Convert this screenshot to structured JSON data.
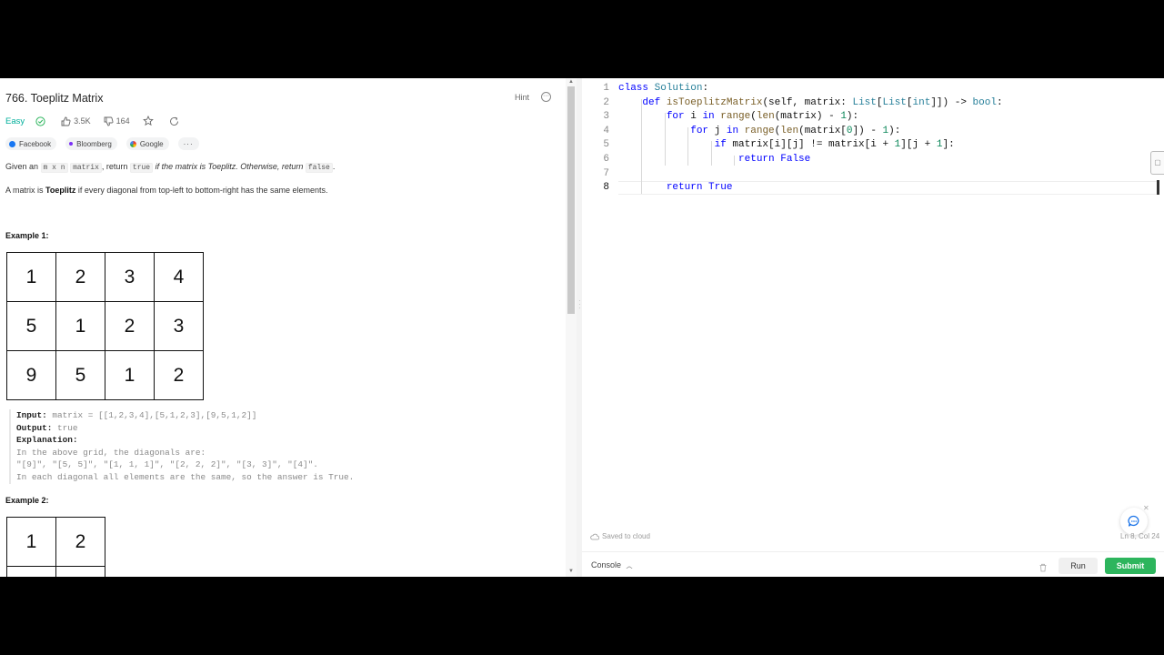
{
  "problem": {
    "title": "766. Toeplitz Matrix",
    "hint_label": "Hint",
    "difficulty": "Easy",
    "likes": "3.5K",
    "dislikes": "164",
    "tags": [
      {
        "label": "Facebook",
        "color": "#1877f2"
      },
      {
        "label": "Bloomberg",
        "color": "#7b2ff7"
      },
      {
        "label": "Google",
        "color": "#ea4335"
      }
    ],
    "more_tags": "···",
    "desc1": {
      "given": "Given an ",
      "mxn": "m x n",
      "matrix": "matrix",
      "return1": ", return ",
      "true": "true",
      "mid": " if the matrix is Toeplitz. Otherwise, return ",
      "false": "false",
      "end": "."
    },
    "desc2": {
      "pre": "A matrix is ",
      "bold": "Toeplitz",
      "post": " if every diagonal from top-left to bottom-right has the same elements."
    }
  },
  "example1": {
    "title": "Example 1:",
    "grid": [
      [
        "1",
        "2",
        "3",
        "4"
      ],
      [
        "5",
        "1",
        "2",
        "3"
      ],
      [
        "9",
        "5",
        "1",
        "2"
      ]
    ],
    "input_label": "Input:",
    "input": " matrix = [[1,2,3,4],[5,1,2,3],[9,5,1,2]]",
    "output_label": "Output:",
    "output": " true",
    "explanation_label": "Explanation:",
    "explanation_lines": [
      "In the above grid, the diagonals are:",
      "\"[9]\", \"[5, 5]\", \"[1, 1, 1]\", \"[2, 2, 2]\", \"[3, 3]\", \"[4]\".",
      "In each diagonal all elements are the same, so the answer is True."
    ]
  },
  "example2": {
    "title": "Example 2:",
    "grid_top": [
      "1",
      "2"
    ]
  },
  "editor": {
    "line_numbers": [
      "1",
      "2",
      "3",
      "4",
      "5",
      "6",
      "7",
      "8"
    ],
    "saved_label": "Saved to cloud",
    "cursor_pos": "Ln 8, Col 24"
  },
  "bottom": {
    "console_label": "Console",
    "run_label": "Run",
    "submit_label": "Submit"
  },
  "colors": {
    "easy": "#00af9b",
    "submit": "#2db55d"
  }
}
